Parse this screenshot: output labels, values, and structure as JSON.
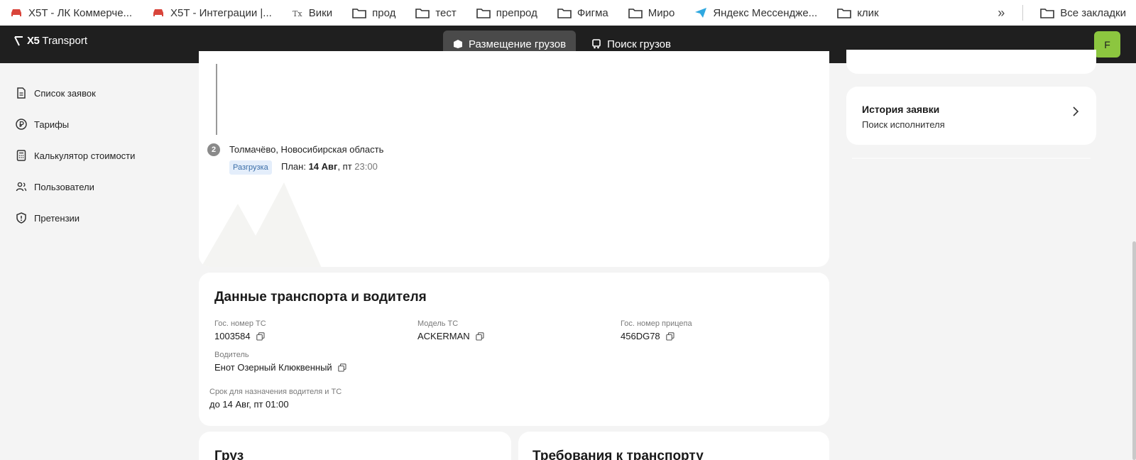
{
  "bookmarks": {
    "items": [
      {
        "label": "X5T - ЛК Коммерче...",
        "icon": "car-icon"
      },
      {
        "label": "X5T - Интеграции |...",
        "icon": "car-icon"
      },
      {
        "label": "Вики",
        "icon": "wiki-icon"
      },
      {
        "label": "прод",
        "icon": "folder-icon"
      },
      {
        "label": "тест",
        "icon": "folder-icon"
      },
      {
        "label": "препрод",
        "icon": "folder-icon"
      },
      {
        "label": "Фигма",
        "icon": "folder-icon"
      },
      {
        "label": "Миро",
        "icon": "folder-icon"
      },
      {
        "label": "Яндекс Мессендже...",
        "icon": "paper-plane-icon"
      },
      {
        "label": "клик",
        "icon": "folder-icon"
      }
    ],
    "more": "»",
    "all_bookmarks": "Все закладки"
  },
  "header": {
    "logo": "Transport",
    "logo_mark": "X5",
    "nav": [
      {
        "label": "Размещение грузов",
        "icon": "box-icon",
        "active": true
      },
      {
        "label": "Поиск грузов",
        "icon": "truck-icon",
        "active": false
      }
    ],
    "avatar": "F"
  },
  "sidebar": {
    "items": [
      {
        "label": "Список заявок",
        "icon": "document-icon"
      },
      {
        "label": "Тарифы",
        "icon": "ruble-icon"
      },
      {
        "label": "Калькулятор стоимости",
        "icon": "calculator-icon"
      },
      {
        "label": "Пользователи",
        "icon": "users-icon"
      },
      {
        "label": "Претензии",
        "icon": "shield-icon"
      }
    ]
  },
  "route": {
    "stop_number": "2",
    "place": "Толмачёво, Новосибирская область",
    "badge": "Разгрузка",
    "plan_label": "План:",
    "plan_date": "14 Авг",
    "plan_day": ", пт",
    "plan_time": "23:00"
  },
  "transport": {
    "title": "Данные транспорта и водителя",
    "vehicle_number_label": "Гос. номер ТС",
    "vehicle_number": "1003584",
    "model_label": "Модель ТС",
    "model": "ACKERMAN",
    "trailer_label": "Гос. номер прицепа",
    "trailer": "456DG78",
    "driver_label": "Водитель",
    "driver": "Енот Озерный Клюквенный",
    "deadline_label": "Срок для назначения водителя и ТС",
    "deadline": "до 14 Авг, пт 01:00"
  },
  "cargo": {
    "title": "Груз"
  },
  "requirements": {
    "title": "Требования к транспорту"
  },
  "history": {
    "title": "История заявки",
    "subtitle": "Поиск исполнителя"
  }
}
